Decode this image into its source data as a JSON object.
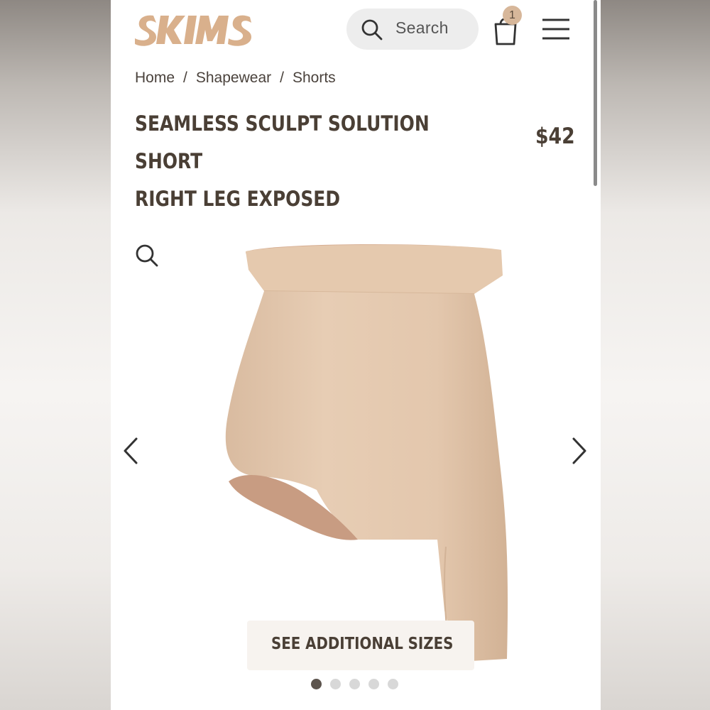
{
  "brand": {
    "logo_text": "SKIMS",
    "logo_color": "#d9b08c"
  },
  "header": {
    "search_placeholder": "Search",
    "cart_count": "1",
    "icons": [
      "search-icon",
      "shopping-bag-icon",
      "hamburger-menu-icon"
    ]
  },
  "breadcrumb": {
    "items": [
      "Home",
      "Shapewear",
      "Shorts"
    ],
    "separator": "/"
  },
  "product": {
    "title_line1": "SEAMLESS SCULPT SOLUTION SHORT",
    "title_line2": "RIGHT LEG EXPOSED",
    "price": "$42",
    "color_swatch": "#e4c7ab"
  },
  "gallery": {
    "zoom_icon": "zoom-icon",
    "prev_icon": "chevron-left-icon",
    "next_icon": "chevron-right-icon",
    "sizes_button": "SEE ADDITIONAL SIZES",
    "slide_count": 5,
    "active_slide": 1
  },
  "colors": {
    "text_dark": "#4a3f35",
    "dot_active": "#5c544d",
    "dot_inactive": "#d8d8d8"
  }
}
